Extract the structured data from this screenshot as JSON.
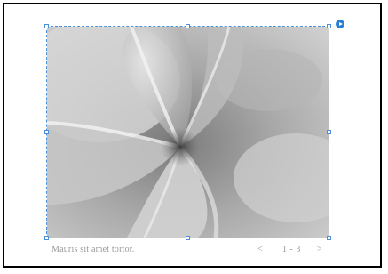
{
  "slideshow": {
    "caption": "Mauris sit amet tortor.",
    "prev_symbol": "<",
    "next_symbol": ">",
    "counter": "1 - 3"
  },
  "icons": {
    "corner_action": "play-circle-icon"
  },
  "colors": {
    "selection": "#4a90d9",
    "action_button": "#2a7fd4",
    "caption_text": "#9a9a9a"
  }
}
